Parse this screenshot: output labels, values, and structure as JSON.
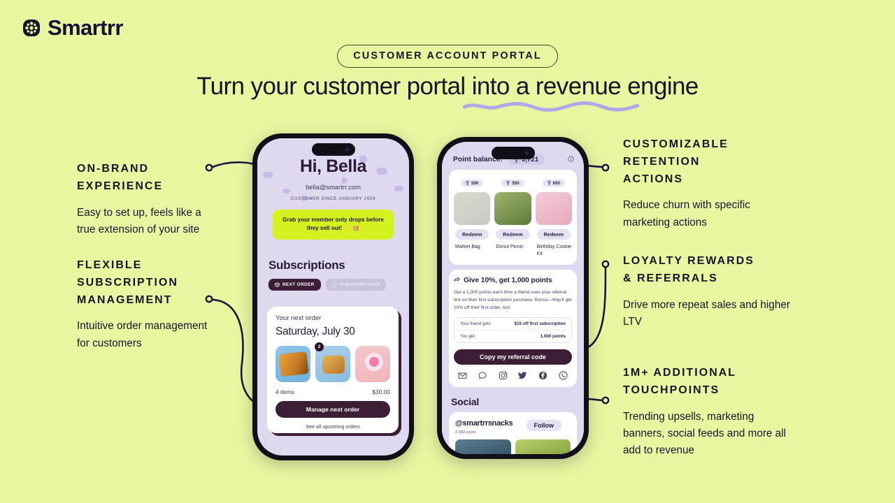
{
  "brand": {
    "name": "Smartrr",
    "logo_icon": "smartrr-flower-mark"
  },
  "header": {
    "eyebrow": "CUSTOMER ACCOUNT PORTAL",
    "headline": "Turn your customer portal into a revenue engine"
  },
  "colors": {
    "background": "#e9f6a0",
    "ink": "#17142f",
    "plum": "#3c1f36",
    "lavender": "#ded9ef",
    "lime": "#d4f21f",
    "squiggle": "#b0a7e8"
  },
  "features": [
    {
      "id": "on-brand",
      "title": "ON-BRAND\nEXPERIENCE",
      "body": "Easy to set up, feels like a\ntrue extension of your site"
    },
    {
      "id": "flexible-subscription",
      "title": "FLEXIBLE\nSUBSCRIPTION\nMANAGEMENT",
      "body": "Intuitive order management\nfor customers"
    },
    {
      "id": "customizable-retention",
      "title": "CUSTOMIZABLE\nRETENTION\nACTIONS",
      "body": "Reduce churn with specific\nmarketing actions"
    },
    {
      "id": "loyalty-rewards",
      "title": "LOYALTY REWARDS\n& REFERRALS",
      "body": "Drive more repeat sales and higher\nLTV"
    },
    {
      "id": "additional-touchpoints",
      "title": "1M+ ADDITIONAL\nTOUCHPOINTS",
      "body": "Trending upsells, marketing\nbanners, social feeds and more all\nadd to revenue"
    }
  ],
  "phone_left": {
    "greeting": "Hi, Bella",
    "email": "bella@smartrr.com",
    "since": "CUSTOMER SINCE JANUARY 2024",
    "banner": "Grab your member only drops before\nthey sell out! ✨ 🧺",
    "section_title": "Subscriptions",
    "tabs": [
      {
        "label": "NEXT ORDER",
        "icon": "box-icon",
        "active": true
      },
      {
        "label": "SUBSCRIPTIONS",
        "icon": "refresh-icon",
        "active": false
      }
    ],
    "order_card": {
      "label": "Your next order",
      "date": "Saturday, July 30",
      "badge_count": "2",
      "items_count": "4 items",
      "total": "$30.00",
      "cta": "Manage next order",
      "link": "See all upcoming orders"
    }
  },
  "phone_right": {
    "points_label": "Point balance:",
    "points_value": "3,721",
    "points_icon": "trophy-icon",
    "info_icon": "info-icon",
    "rewards": [
      {
        "points": "500",
        "button": "Redeem",
        "name": "Market Bag"
      },
      {
        "points": "550",
        "button": "Redeem",
        "name": "Donut Picnic"
      },
      {
        "points": "600",
        "button": "Redeem",
        "name": "Birthday\nCookie Kit"
      }
    ],
    "referral": {
      "icon": "share-icon",
      "title": "Give 10%, get 1,000 points",
      "body": "Get a 1,000 points each time a friend uses your referral link on their first subscription purchase. Bonus—they'll get 10% off their first order, too!",
      "rows": [
        {
          "label": "Your friend gets",
          "value": "$15 off first subscription"
        },
        {
          "label": "You get",
          "value": "1,000 points"
        }
      ],
      "cta": "Copy my referral code",
      "share_icons": [
        "email-icon",
        "message-icon",
        "instagram-icon",
        "twitter-icon",
        "facebook-icon",
        "whatsapp-icon"
      ]
    },
    "social": {
      "title": "Social",
      "handle": "@smartrrsnacks",
      "follow_label": "Follow",
      "posts": "2,582 posts"
    }
  }
}
